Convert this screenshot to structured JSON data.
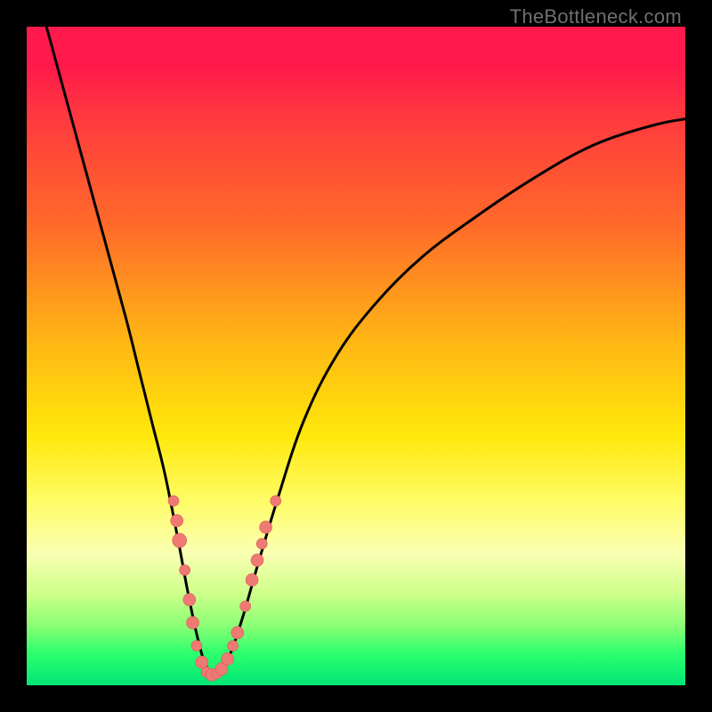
{
  "watermark": "TheBottleneck.com",
  "colors": {
    "curve_stroke": "#000000",
    "dot_fill": "#ef7a74",
    "dot_stroke": "#d85a54"
  },
  "chart_data": {
    "type": "line",
    "title": "",
    "xlabel": "",
    "ylabel": "",
    "xlim": [
      0,
      100
    ],
    "ylim": [
      0,
      100
    ],
    "series": [
      {
        "name": "bottleneck-curve",
        "x": [
          3,
          6,
          9,
          12,
          15,
          17,
          19,
          21,
          23,
          24.5,
          26,
          27.5,
          29.5,
          31,
          33,
          35,
          38,
          42,
          47,
          53,
          60,
          68,
          77,
          86,
          95,
          100
        ],
        "y": [
          100,
          89,
          78,
          67,
          56,
          48,
          40,
          32,
          22,
          14,
          7,
          2.5,
          2.5,
          5,
          11,
          18,
          28,
          40,
          50,
          58,
          65,
          71,
          77,
          82,
          85,
          86
        ]
      }
    ],
    "scatter": {
      "name": "highlight-dots",
      "points": [
        {
          "x": 22.3,
          "y": 28.0,
          "r": 6
        },
        {
          "x": 22.8,
          "y": 25.0,
          "r": 7
        },
        {
          "x": 23.2,
          "y": 22.0,
          "r": 8
        },
        {
          "x": 24.0,
          "y": 17.5,
          "r": 6
        },
        {
          "x": 24.7,
          "y": 13.0,
          "r": 7
        },
        {
          "x": 25.2,
          "y": 9.5,
          "r": 7
        },
        {
          "x": 25.8,
          "y": 6.0,
          "r": 6
        },
        {
          "x": 26.6,
          "y": 3.5,
          "r": 7
        },
        {
          "x": 27.3,
          "y": 2.0,
          "r": 6
        },
        {
          "x": 28.1,
          "y": 1.6,
          "r": 7
        },
        {
          "x": 28.9,
          "y": 1.8,
          "r": 6
        },
        {
          "x": 29.6,
          "y": 2.5,
          "r": 7
        },
        {
          "x": 30.5,
          "y": 4.0,
          "r": 7
        },
        {
          "x": 31.3,
          "y": 6.0,
          "r": 6
        },
        {
          "x": 32.0,
          "y": 8.0,
          "r": 7
        },
        {
          "x": 33.2,
          "y": 12.0,
          "r": 6
        },
        {
          "x": 34.2,
          "y": 16.0,
          "r": 7
        },
        {
          "x": 35.0,
          "y": 19.0,
          "r": 7
        },
        {
          "x": 35.7,
          "y": 21.5,
          "r": 6
        },
        {
          "x": 36.3,
          "y": 24.0,
          "r": 7
        },
        {
          "x": 37.8,
          "y": 28.0,
          "r": 6
        }
      ]
    }
  }
}
